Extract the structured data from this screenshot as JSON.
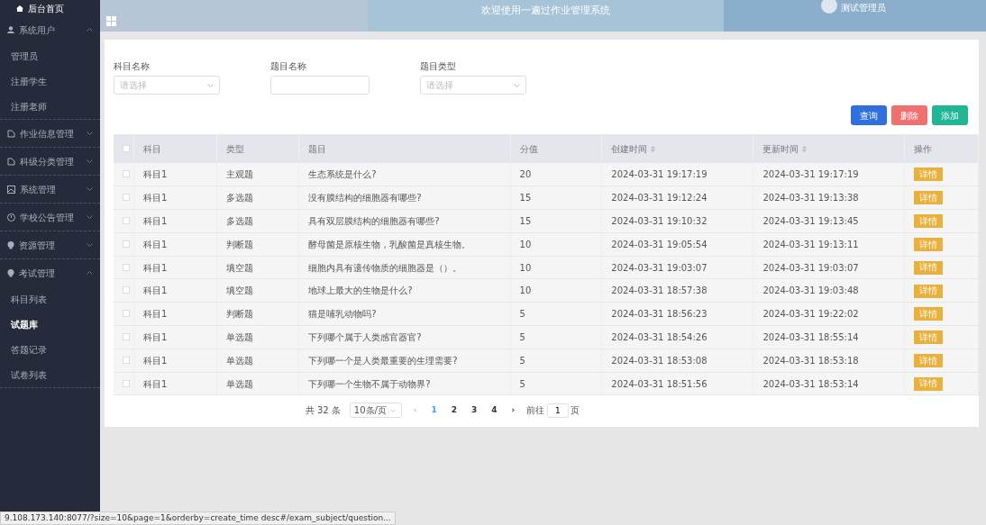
{
  "sidebar": {
    "home": "后台首页",
    "groups": [
      {
        "label": "系统用户",
        "expanded": true,
        "children": [
          {
            "label": "管理员",
            "selected": false
          },
          {
            "label": "注册学生",
            "selected": false
          },
          {
            "label": "注册老师",
            "selected": false
          }
        ]
      },
      {
        "label": "作业信息管理",
        "expanded": false
      },
      {
        "label": "科级分类管理",
        "expanded": false
      },
      {
        "label": "系统管理",
        "expanded": false
      },
      {
        "label": "学校公告管理",
        "expanded": false
      },
      {
        "label": "资源管理",
        "expanded": false
      },
      {
        "label": "考试管理",
        "expanded": true,
        "children": [
          {
            "label": "科目列表",
            "selected": false
          },
          {
            "label": "试题库",
            "selected": true
          },
          {
            "label": "答题记录",
            "selected": false
          },
          {
            "label": "试卷列表",
            "selected": false
          }
        ]
      }
    ]
  },
  "header": {
    "title": "欢迎使用一遍过作业管理系统",
    "user": "测试管理员"
  },
  "filters": [
    {
      "label": "科目名称",
      "kind": "select",
      "placeholder": "请选择"
    },
    {
      "label": "题目名称",
      "kind": "input"
    },
    {
      "label": "题目类型",
      "kind": "select",
      "placeholder": "请选择"
    }
  ],
  "buttons": [
    {
      "label": "查询",
      "kind": "primary"
    },
    {
      "label": "删除",
      "kind": "danger"
    },
    {
      "label": "添加",
      "kind": "success"
    }
  ],
  "table": {
    "all_checked": false,
    "columns": [
      {
        "label": "科目",
        "sortable": false
      },
      {
        "label": "类型",
        "sortable": false
      },
      {
        "label": "题目",
        "sortable": false
      },
      {
        "label": "分值",
        "sortable": false
      },
      {
        "label": "创建时间",
        "sortable": true
      },
      {
        "label": "更新时间",
        "sortable": true
      },
      {
        "label": "操作",
        "sortable": false
      }
    ],
    "rows": [
      {
        "checked": false,
        "cells": [
          "科目1",
          "主观题",
          "生态系统是什么?",
          "20",
          "2024-03-31 19:17:19",
          "2024-03-31 19:17:19"
        ],
        "action": "详情"
      },
      {
        "checked": false,
        "cells": [
          "科目1",
          "多选题",
          "没有膜结构的细胞器有哪些?",
          "15",
          "2024-03-31 19:12:24",
          "2024-03-31 19:13:38"
        ],
        "action": "详情"
      },
      {
        "checked": false,
        "cells": [
          "科目1",
          "多选题",
          "具有双层膜结构的细胞器有哪些?",
          "15",
          "2024-03-31 19:10:32",
          "2024-03-31 19:13:45"
        ],
        "action": "详情"
      },
      {
        "checked": false,
        "cells": [
          "科目1",
          "判断题",
          "酵母菌是原核生物，乳酸菌是真核生物。",
          "10",
          "2024-03-31 19:05:54",
          "2024-03-31 19:13:11"
        ],
        "action": "详情"
      },
      {
        "checked": false,
        "cells": [
          "科目1",
          "填空题",
          "细胞内具有遗传物质的细胞器是（）。",
          "10",
          "2024-03-31 19:03:07",
          "2024-03-31 19:03:07"
        ],
        "action": "详情"
      },
      {
        "checked": false,
        "cells": [
          "科目1",
          "填空题",
          "地球上最大的生物是什么?",
          "10",
          "2024-03-31 18:57:38",
          "2024-03-31 19:03:48"
        ],
        "action": "详情"
      },
      {
        "checked": false,
        "cells": [
          "科目1",
          "判断题",
          "猫是哺乳动物吗?",
          "5",
          "2024-03-31 18:56:23",
          "2024-03-31 19:22:02"
        ],
        "action": "详情"
      },
      {
        "checked": false,
        "cells": [
          "科目1",
          "单选题",
          "下列哪个属于人类感官器官?",
          "5",
          "2024-03-31 18:54:26",
          "2024-03-31 18:55:14"
        ],
        "action": "详情"
      },
      {
        "checked": false,
        "cells": [
          "科目1",
          "单选题",
          "下列哪一个是人类最重要的生理需要?",
          "5",
          "2024-03-31 18:53:08",
          "2024-03-31 18:53:18"
        ],
        "action": "详情"
      },
      {
        "checked": false,
        "cells": [
          "科目1",
          "单选题",
          "下列哪一个生物不属于动物界?",
          "5",
          "2024-03-31 18:51:56",
          "2024-03-31 18:53:14"
        ],
        "action": "详情"
      }
    ]
  },
  "pagination": {
    "total": "共 32 条",
    "page_size": "10条/页",
    "prev": "‹",
    "next": "›",
    "pages": [
      {
        "label": "1",
        "selected": true
      },
      {
        "label": "2",
        "selected": false
      },
      {
        "label": "3",
        "selected": false
      },
      {
        "label": "4",
        "selected": false
      }
    ],
    "goto_label": "前往",
    "goto_value": "1",
    "page_unit": "页"
  },
  "status_bar": "9.108.173.140:8077/?size=10&page=1&orderby=create_time desc#/exam_subject/question..."
}
